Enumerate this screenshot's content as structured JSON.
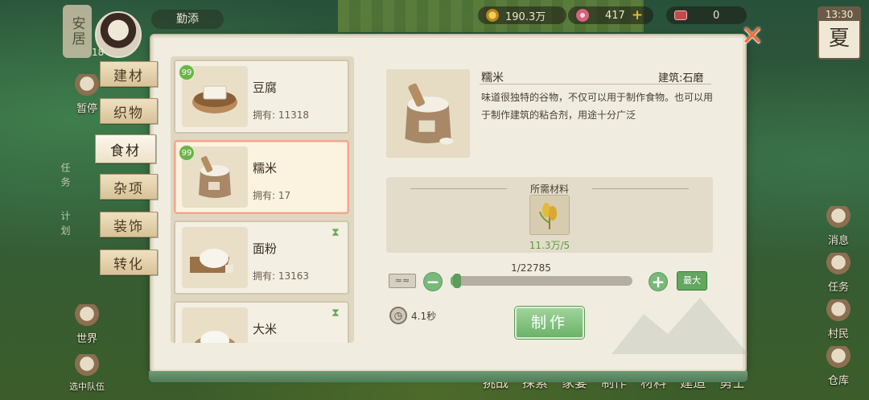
{
  "hud": {
    "city_label": "安居",
    "level": "18",
    "player_name": "勤添",
    "resources": [
      {
        "icon": "coin-icon",
        "value": "190.3万"
      },
      {
        "icon": "flower-icon",
        "value": "417"
      },
      {
        "icon": "token-icon",
        "value": "0"
      }
    ],
    "time": "13:30",
    "season": "夏"
  },
  "side_buttons": {
    "left": [
      {
        "label": "暂停",
        "icon": "pause-icon"
      },
      {
        "label": "世界",
        "icon": "world-icon"
      },
      {
        "label": "选中队伍",
        "icon": "team-icon"
      }
    ],
    "vertical": [
      "任务",
      "计划"
    ],
    "right": [
      {
        "label": "消息",
        "icon": "message-icon"
      },
      {
        "label": "任务",
        "icon": "quest-icon"
      },
      {
        "label": "村民",
        "icon": "villager-icon"
      },
      {
        "label": "仓库",
        "icon": "warehouse-icon"
      }
    ]
  },
  "bottom_nav": [
    "挑战",
    "探索",
    "家宴",
    "制作",
    "材料",
    "建造",
    "勇士"
  ],
  "tabs": [
    {
      "label": "建材",
      "active": false
    },
    {
      "label": "织物",
      "active": false
    },
    {
      "label": "食材",
      "active": true
    },
    {
      "label": "杂项",
      "active": false
    },
    {
      "label": "装饰",
      "active": false
    },
    {
      "label": "转化",
      "active": false
    }
  ],
  "items": [
    {
      "name": "豆腐",
      "own": "拥有: 11318",
      "badge": "99",
      "hourglass": false,
      "selected": false,
      "icon": "tofu-icon"
    },
    {
      "name": "糯米",
      "own": "拥有: 17",
      "badge": "99",
      "hourglass": false,
      "selected": true,
      "icon": "rice-sack-icon"
    },
    {
      "name": "面粉",
      "own": "拥有: 13163",
      "badge": "",
      "hourglass": true,
      "selected": false,
      "icon": "flour-icon"
    },
    {
      "name": "大米",
      "own": "",
      "badge": "",
      "hourglass": true,
      "selected": false,
      "icon": "rice-icon"
    }
  ],
  "detail": {
    "name": "糯米",
    "building": "建筑:石磨",
    "description": "味道很独特的谷物，不仅可以用于制作食物。也可以用于制作建筑的粘合剂，用途十分广泛",
    "materials_title": "所需材料",
    "material": {
      "icon": "millet-icon",
      "count": "11.3万/5"
    },
    "quantity": "1/22785",
    "quantity_fraction": 4e-05,
    "max_label": "最大",
    "craft_time": "4.1秒",
    "craft_label": "制作"
  },
  "colors": {
    "accent_green": "#6cb269",
    "close_orange": "#ef6f3a",
    "selected_border": "#f0a88d"
  }
}
